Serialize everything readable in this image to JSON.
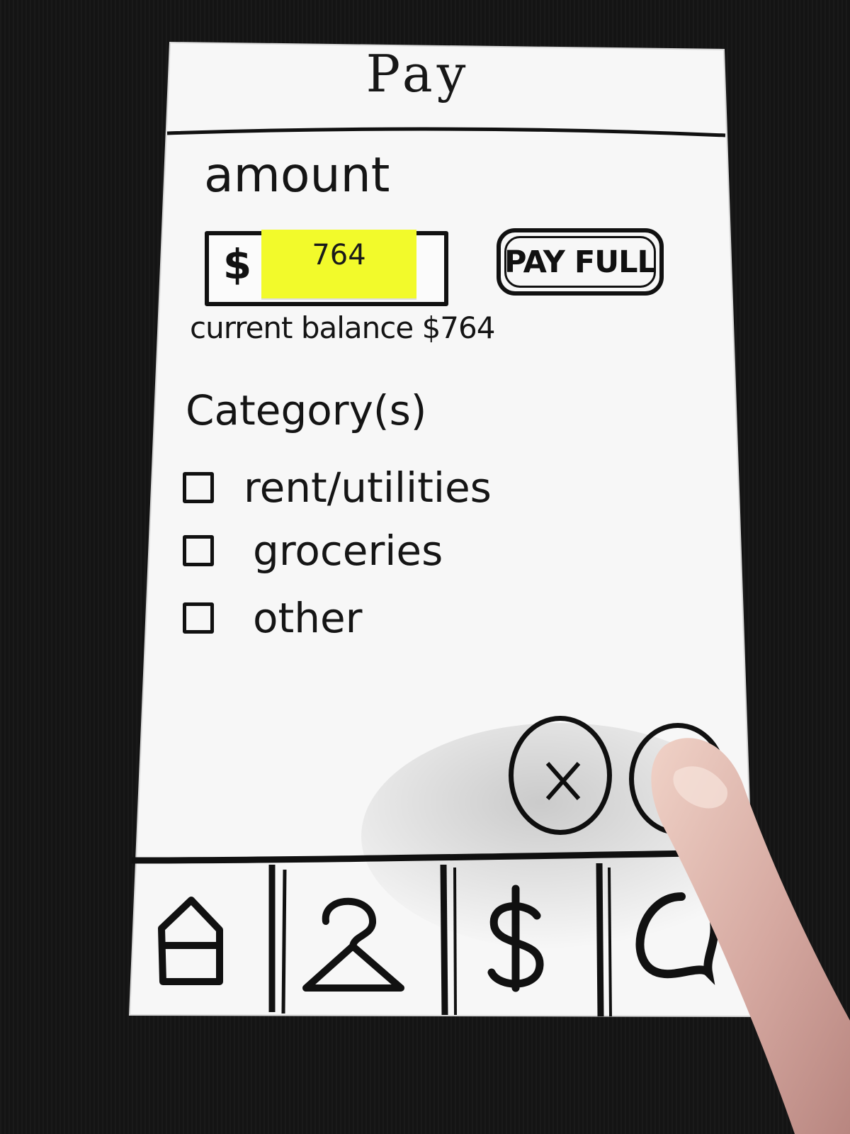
{
  "header": {
    "title": "Pay"
  },
  "amount": {
    "label": "amount",
    "currency_symbol": "$",
    "value": "764",
    "pay_full_label": "PAY FULL",
    "balance_text": "current balance $764"
  },
  "categories": {
    "label": "Category(s)",
    "items": [
      {
        "label": "rent/utilities",
        "checked": false
      },
      {
        "label": "groceries",
        "checked": false
      },
      {
        "label": "other",
        "checked": false
      }
    ]
  },
  "actions": {
    "cancel_icon": "close-icon",
    "confirm_icon": "confirm-icon"
  },
  "bottom_nav": {
    "items": [
      {
        "icon": "home-icon"
      },
      {
        "icon": "hanger-icon"
      },
      {
        "icon": "dollar-icon"
      },
      {
        "icon": "chat-icon"
      }
    ]
  },
  "colors": {
    "paper": "#f7f7f7",
    "ink": "#111111",
    "sticky_note": "#f2fa2b",
    "background": "#141414"
  }
}
